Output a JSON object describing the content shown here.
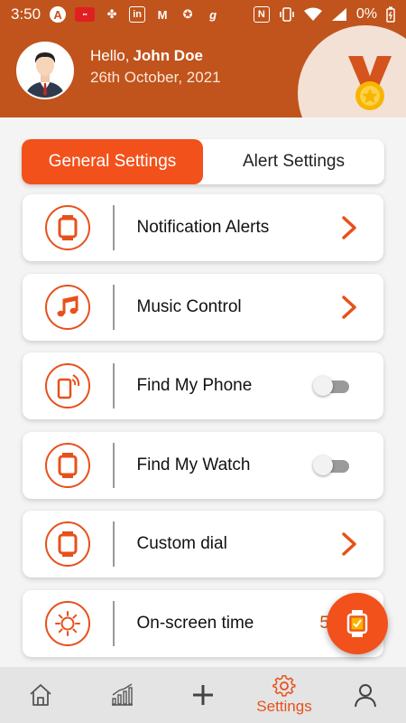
{
  "status_bar": {
    "time": "3:50",
    "battery": "0%"
  },
  "header": {
    "greeting": "Hello,",
    "user_name": "John Doe",
    "date": "26th October, 2021"
  },
  "tabs": [
    {
      "label": "General Settings",
      "active": true
    },
    {
      "label": "Alert Settings",
      "active": false
    }
  ],
  "settings": [
    {
      "label": "Notification Alerts",
      "icon": "watch-icon",
      "control": "chevron"
    },
    {
      "label": "Music Control",
      "icon": "music-note-icon",
      "control": "chevron"
    },
    {
      "label": "Find My Phone",
      "icon": "phone-ring-icon",
      "control": "toggle",
      "enabled": false
    },
    {
      "label": "Find My Watch",
      "icon": "watch-icon",
      "control": "toggle",
      "enabled": false
    },
    {
      "label": "Custom dial",
      "icon": "watch-icon",
      "control": "chevron"
    },
    {
      "label": "On-screen time",
      "icon": "sun-icon",
      "control": "value",
      "value": "5"
    }
  ],
  "bottom_nav": [
    {
      "icon": "home-icon",
      "label": ""
    },
    {
      "icon": "chart-icon",
      "label": ""
    },
    {
      "icon": "plus-icon",
      "label": ""
    },
    {
      "icon": "gear-icon",
      "label": "Settings",
      "active": true
    },
    {
      "icon": "profile-icon",
      "label": ""
    }
  ],
  "colors": {
    "header_bg": "#c0541c",
    "accent": "#f2511b",
    "icon_stroke": "#e8501a"
  }
}
